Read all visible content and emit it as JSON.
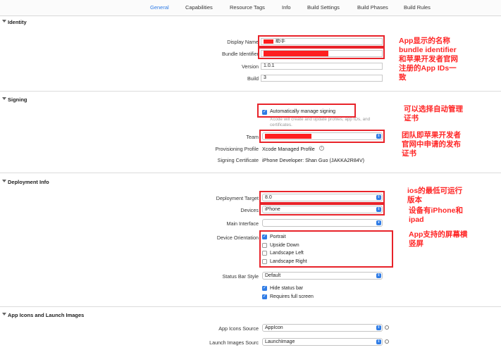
{
  "tabs": [
    "General",
    "Capabilities",
    "Resource Tags",
    "Info",
    "Build Settings",
    "Build Phases",
    "Build Rules"
  ],
  "identity": {
    "title": "Identity",
    "display_name_label": "Display Name",
    "display_name_value": "助手",
    "bundle_identifier_label": "Bundle Identifier",
    "version_label": "Version",
    "version_value": "1.0.1",
    "build_label": "Build",
    "build_value": "3"
  },
  "signing": {
    "title": "Signing",
    "auto_manage_label": "Automatically manage signing",
    "auto_manage_checked": true,
    "auto_manage_hint_1": "Xcode will create and update profiles, app IDs, and",
    "auto_manage_hint_2": "certificates.",
    "team_label": "Team",
    "provisioning_profile_label": "Provisioning Profile",
    "provisioning_profile_value": "Xcode Managed Profile",
    "signing_certificate_label": "Signing Certificate",
    "signing_certificate_value": "iPhone Developer: Shan Guo (JAKKA2R84V)"
  },
  "deployment": {
    "title": "Deployment Info",
    "target_label": "Deployment Target",
    "target_value": "8.0",
    "devices_label": "Devices",
    "devices_value": "iPhone",
    "main_interface_label": "Main Interface",
    "main_interface_value": "",
    "orientation_label": "Device Orientation",
    "orientations": [
      {
        "label": "Portrait",
        "checked": true
      },
      {
        "label": "Upside Down",
        "checked": false
      },
      {
        "label": "Landscape Left",
        "checked": false
      },
      {
        "label": "Landscape Right",
        "checked": false
      }
    ],
    "status_bar_style_label": "Status Bar Style",
    "status_bar_style_value": "Default",
    "hide_status_bar_label": "Hide status bar",
    "hide_status_bar_checked": true,
    "requires_full_screen_label": "Requires full screen",
    "requires_full_screen_checked": true
  },
  "app_icons": {
    "title": "App Icons and Launch Images",
    "icons_source_label": "App Icons Source",
    "icons_source_value": "AppIcon",
    "launch_images_label": "Launch Images Sourc",
    "launch_images_value": "LaunchImage"
  },
  "annotations": {
    "identity_1": "App显示的名称",
    "identity_2": "bundle identifier",
    "identity_3": "和苹果开发者官网",
    "identity_4": "注册的App IDs一",
    "identity_5": "致",
    "signing_1": "可以选择自动管理",
    "signing_2": "证书",
    "team_1": "团队即苹果开发者",
    "team_2": "官网中申请的发布",
    "team_3": "证书",
    "target_1": "ios的最低可运行",
    "target_2": "版本",
    "devices_1": "设备有iPhone和",
    "devices_2": "ipad",
    "orientation_1": "App支持的屏幕横",
    "orientation_2": "竖屏"
  },
  "colors": {
    "accent": "#2f7ce6",
    "annotation_red": "#ff2626"
  },
  "icons": {
    "section_toggle": "disclosure-triangle-icon",
    "popup_arrows": "updown-arrows-icon",
    "info": "info-icon",
    "go_to": "go-to-arrow-icon"
  }
}
